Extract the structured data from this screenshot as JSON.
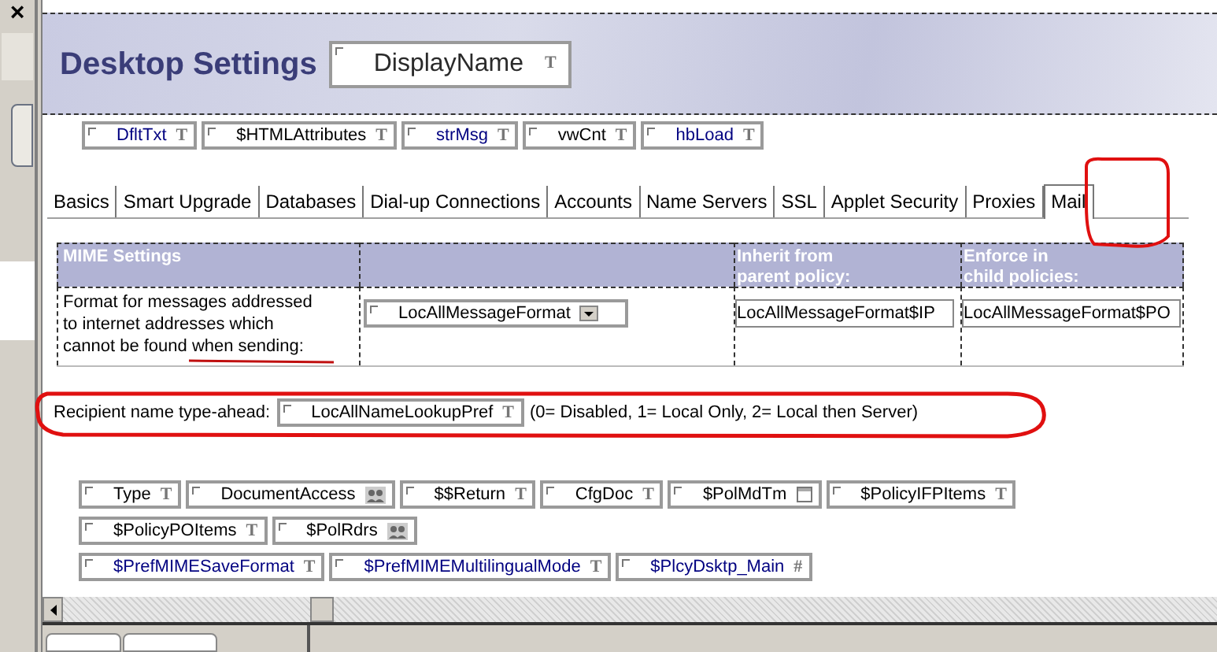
{
  "side_panel": {
    "close": "×"
  },
  "header": {
    "title": "Desktop Settings",
    "field": {
      "name": "DisplayName",
      "kind": "text",
      "glyph": "T",
      "color": "#2a2a2a"
    }
  },
  "top_fields": [
    {
      "name": "DfltTxt",
      "kind": "text",
      "glyph": "T",
      "color": "#000080"
    },
    {
      "name": "$HTMLAttributes",
      "kind": "text",
      "glyph": "T",
      "color": "#000000"
    },
    {
      "name": "strMsg",
      "kind": "text",
      "glyph": "T",
      "color": "#000080"
    },
    {
      "name": "vwCnt",
      "kind": "text",
      "glyph": "T",
      "color": "#000000"
    },
    {
      "name": "hbLoad",
      "kind": "text",
      "glyph": "T",
      "color": "#000080"
    }
  ],
  "tabs": [
    {
      "label": "Basics",
      "selected": false
    },
    {
      "label": "Smart Upgrade",
      "selected": false
    },
    {
      "label": "Databases",
      "selected": false
    },
    {
      "label": "Dial-up Connections",
      "selected": false
    },
    {
      "label": "Accounts",
      "selected": false
    },
    {
      "label": "Name Servers",
      "selected": false
    },
    {
      "label": "SSL",
      "selected": false
    },
    {
      "label": "Applet Security",
      "selected": false
    },
    {
      "label": "Proxies",
      "selected": false
    },
    {
      "label": "Mail",
      "selected": true
    }
  ],
  "table": {
    "columns": [
      "MIME Settings",
      "",
      "Inherit from\nparent policy:",
      "Enforce in\nchild policies:"
    ],
    "row": {
      "label": "Format for messages addressed to internet addresses which cannot be found when sending:",
      "field": {
        "name": "LocAllMessageFormat",
        "kind": "dialog",
        "color": "#000000"
      },
      "inherit": "LocAllMessageFormat$IP",
      "enforce": "LocAllMessageFormat$PO"
    }
  },
  "recipient": {
    "label": "Recipient name type-ahead:",
    "field": {
      "name": "LocAllNameLookupPref",
      "kind": "text",
      "glyph": "T",
      "color": "#000000"
    },
    "hint": "(0= Disabled, 1= Local Only, 2= Local then Server)"
  },
  "hidden_fields": [
    [
      {
        "name": "Type",
        "kind": "text",
        "glyph": "T",
        "color": "#000000"
      },
      {
        "name": "DocumentAccess",
        "kind": "names",
        "color": "#000000"
      },
      {
        "name": "$$Return",
        "kind": "text",
        "glyph": "T",
        "color": "#000000"
      },
      {
        "name": "CfgDoc",
        "kind": "text",
        "glyph": "T",
        "color": "#000000"
      },
      {
        "name": "$PolMdTm",
        "kind": "date",
        "color": "#000000"
      },
      {
        "name": "$PolicyIFPItems",
        "kind": "text",
        "glyph": "T",
        "color": "#000000"
      }
    ],
    [
      {
        "name": "$PolicyPOItems",
        "kind": "text",
        "glyph": "T",
        "color": "#000000"
      },
      {
        "name": "$PolRdrs",
        "kind": "names",
        "color": "#000000"
      }
    ],
    [
      {
        "name": "$PrefMIMESaveFormat",
        "kind": "text",
        "glyph": "T",
        "color": "#000080"
      },
      {
        "name": "$PrefMIMEMultilingualMode",
        "kind": "text",
        "glyph": "T",
        "color": "#000080"
      },
      {
        "name": "$PlcyDsktp_Main",
        "kind": "number",
        "glyph": "#",
        "color": "#000080"
      }
    ]
  ]
}
